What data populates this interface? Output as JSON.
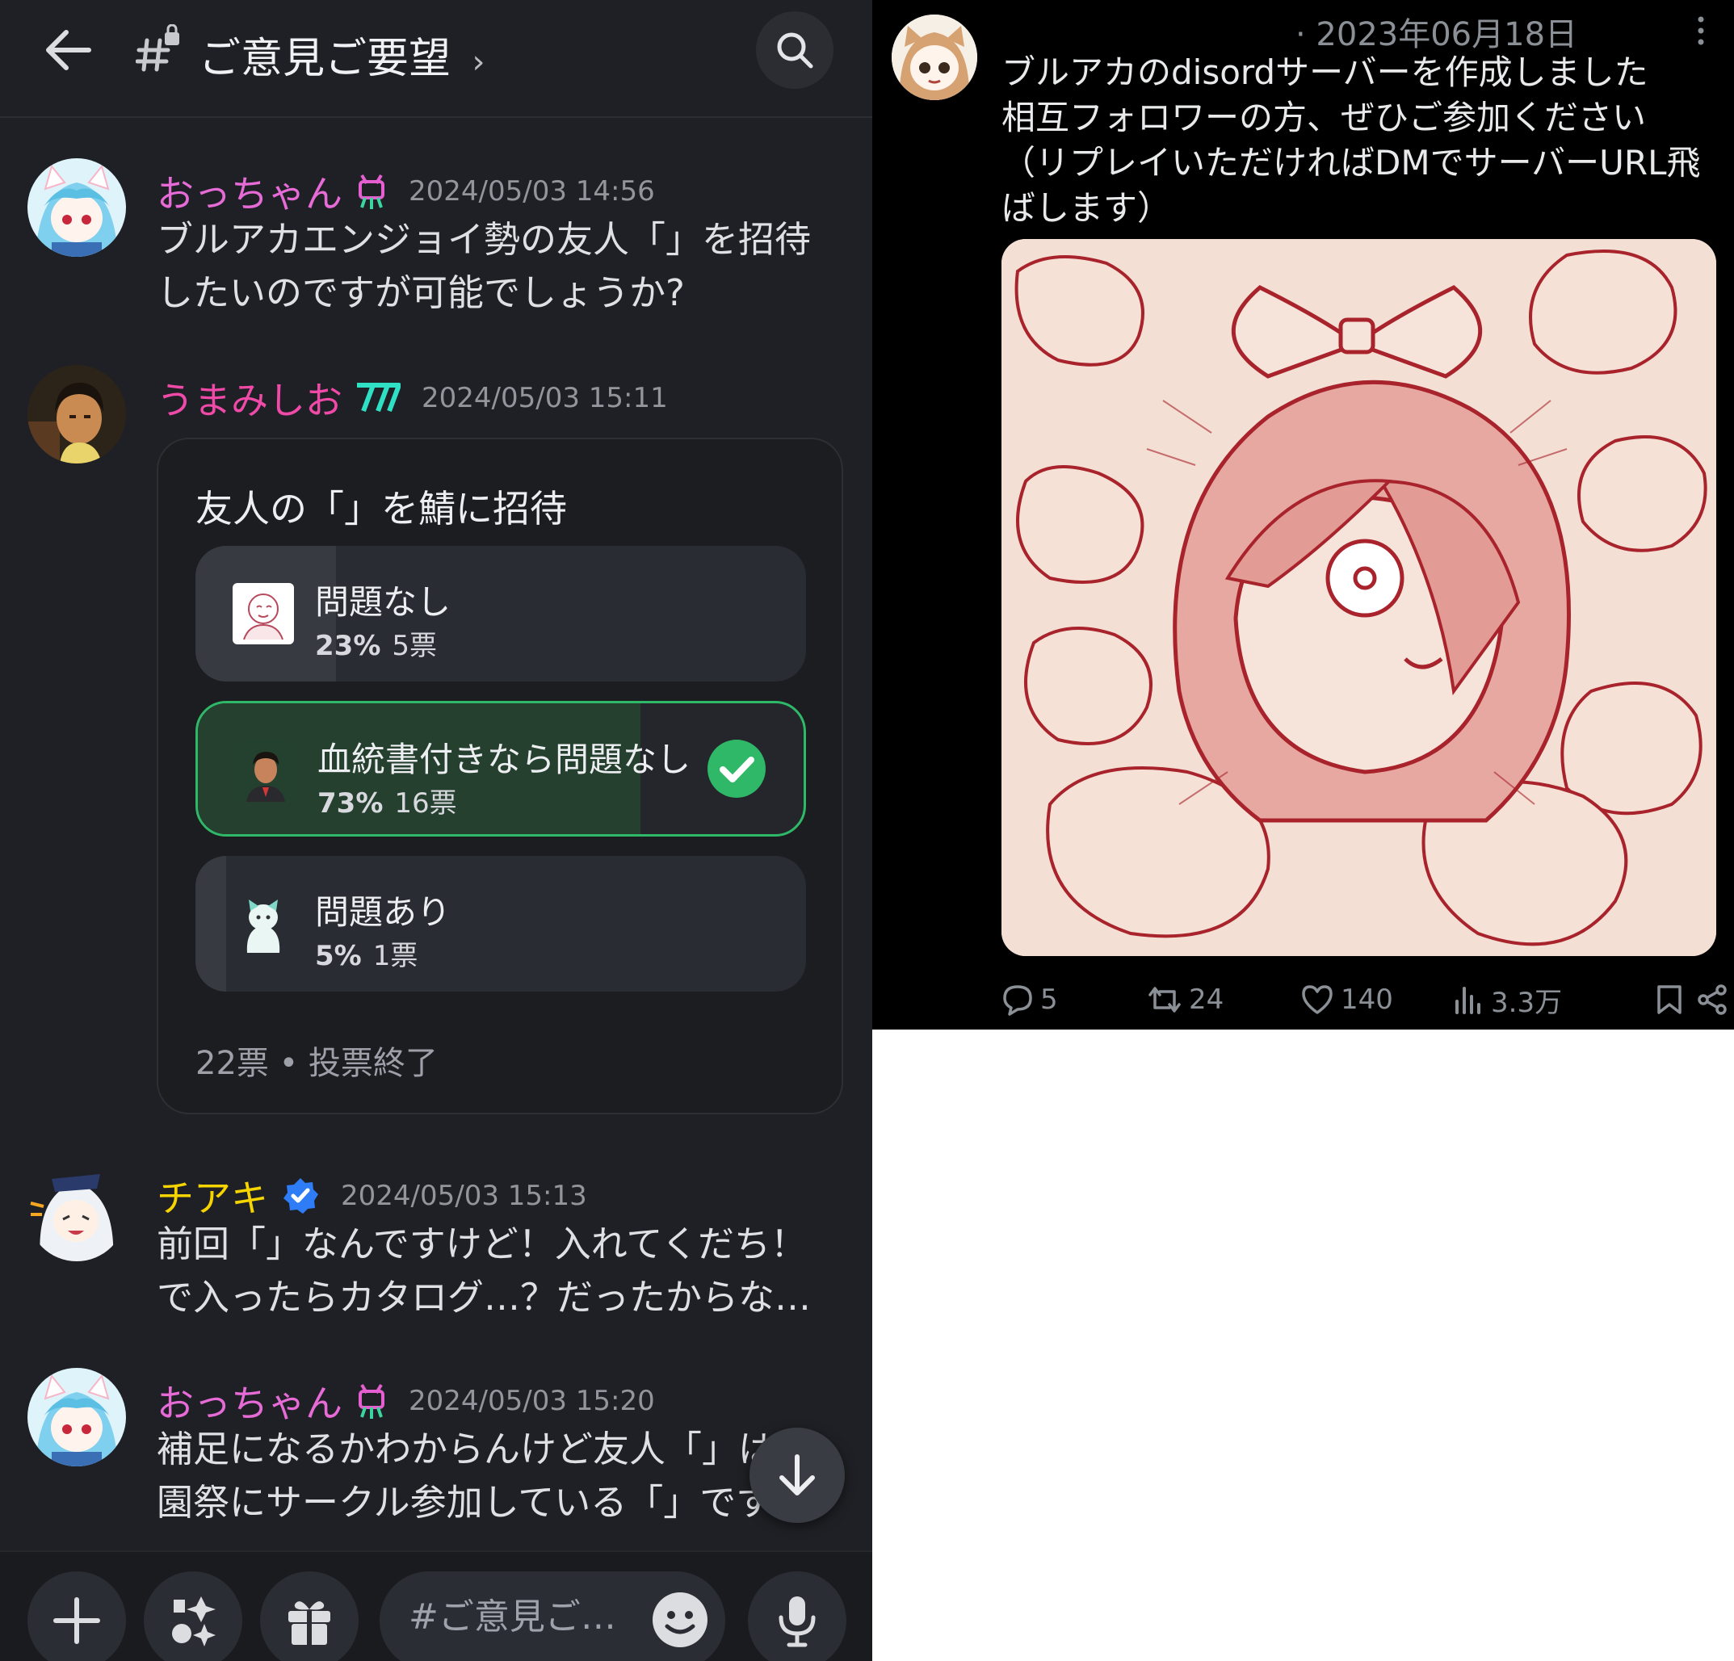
{
  "chat": {
    "channel_title": "ご意見ご要望",
    "channel_chevron": "›",
    "composer_placeholder": "#ご意見ご…",
    "messages": [
      {
        "username": "おっちゃん",
        "username_color": "#e66bd6",
        "timestamp": "2024/05/03 14:56",
        "lines": [
          "ブルアカエンジョイ勢の友人「」を招待",
          "したいのですが可能でしょうか?"
        ]
      },
      {
        "username": "うまみしお",
        "username_color": "#f04aa8",
        "timestamp": "2024/05/03 15:11",
        "poll": {
          "question": "友人の「」を鯖に招待",
          "options": [
            {
              "label": "問題なし",
              "percent_text": "23%",
              "votes_text": "5票",
              "fraction": 0.23,
              "selected": false
            },
            {
              "label": "血統書付きなら問題なし",
              "percent_text": "73%",
              "votes_text": "16票",
              "fraction": 0.73,
              "selected": true
            },
            {
              "label": "問題あり",
              "percent_text": "5%",
              "votes_text": "1票",
              "fraction": 0.05,
              "selected": false
            }
          ],
          "footer": "22票 • 投票終了"
        }
      },
      {
        "username": "チアキ",
        "username_color": "#f5d400",
        "timestamp": "2024/05/03 15:13",
        "lines": [
          "前回「」なんですけど！入れてくだち！",
          "で入ったらカタログ…？だったからな…"
        ]
      },
      {
        "username": "おっちゃん",
        "username_color": "#e66bd6",
        "timestamp": "2024/05/03 15:20",
        "lines": [
          "補足になるかわからんけど友人「」は",
          "園祭にサークル参加している「」です"
        ]
      }
    ],
    "colors": {
      "background": "#1f2025",
      "accent_green": "#2fb867",
      "verified_blue": "#2f7df6"
    }
  },
  "tweet": {
    "date": "· 2023年06月18日",
    "lines": [
      "ブルアカのdisordサーバーを作成しました",
      "相互フォロワーの方、ぜひご参加ください",
      "（リプレイいただければDMでサーバーURL飛",
      "ばします）"
    ],
    "actions": {
      "replies": "5",
      "retweets": "24",
      "likes": "140",
      "views": "3.3万"
    },
    "icons": [
      "reply-icon",
      "retweet-icon",
      "like-icon",
      "views-icon",
      "bookmark-icon",
      "share-icon"
    ]
  }
}
